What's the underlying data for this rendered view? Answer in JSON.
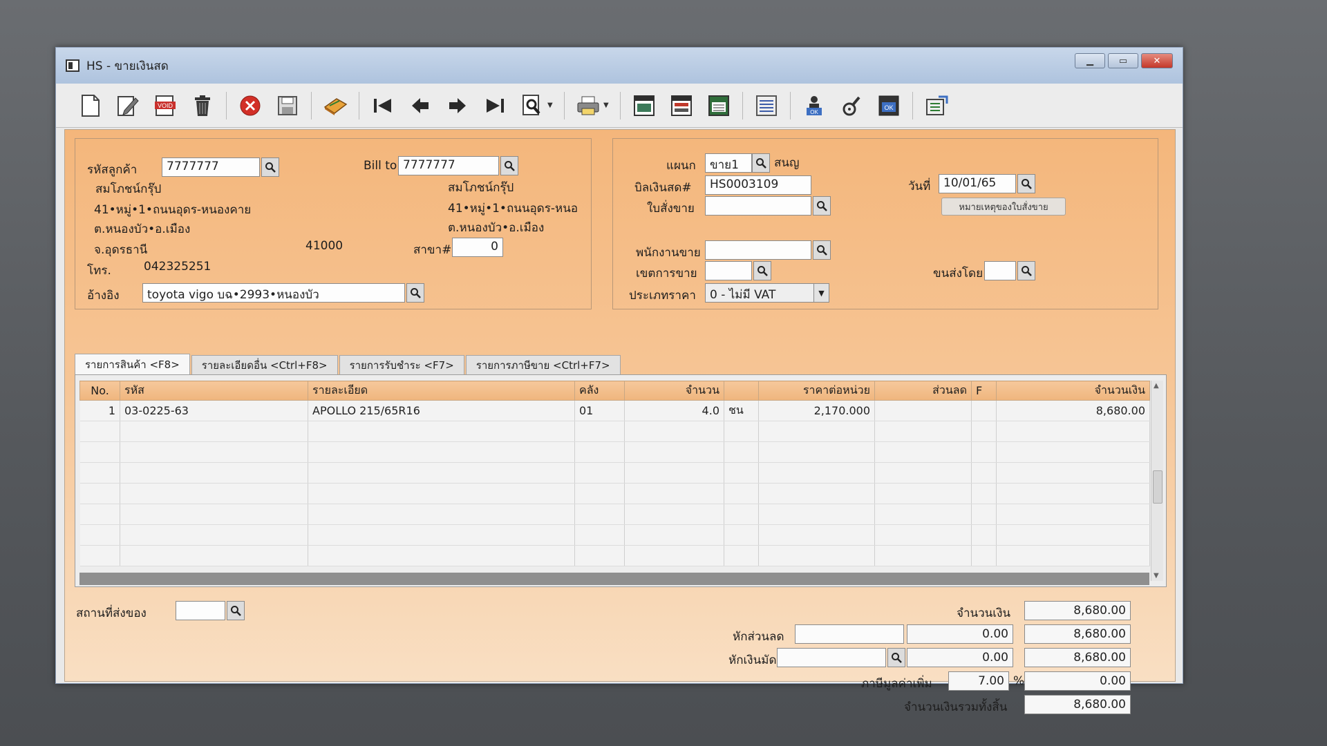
{
  "window": {
    "title": "HS - ขายเงินสด"
  },
  "toolbar": {
    "buttons": [
      "new-doc-icon",
      "edit-icon",
      "void-icon",
      "trash-icon",
      "cancel-icon",
      "save-icon",
      "notebook-icon",
      "first-record-icon",
      "prev-record-icon",
      "next-record-icon",
      "last-record-icon",
      "find-icon",
      "print-icon",
      "report-1-icon",
      "report-2-icon",
      "report-3-icon",
      "list-icon",
      "approve-icon",
      "tool-icon",
      "ok-icon",
      "export-icon"
    ],
    "void_label": "VOID",
    "ok_label": "OK"
  },
  "customer": {
    "code_label": "รหัสลูกค้า",
    "code": "7777777",
    "billto_label": "Bill to",
    "billto_code": "7777777",
    "name": "สมโภชน์กรุ๊ป",
    "address1": "41•หมู่•1•ถนนอุดร-หนองคาย",
    "address2": "ต.หนองบัว•อ.เมือง",
    "province": "จ.อุดรธานี",
    "postcode": "41000",
    "bill_name": "สมโภชน์กรุ๊ป",
    "bill_address1": "41•หมู่•1•ถนนอุดร-หนอ",
    "bill_address2": "ต.หนองบัว•อ.เมือง",
    "branch_label": "สาขา#",
    "branch": "0",
    "phone_label": "โทร.",
    "phone": "042325251",
    "ref_label": "อ้างอิง",
    "ref": "toyota vigo บฉ•2993•หนองบัว"
  },
  "document": {
    "dept_label": "แผนก",
    "dept": "ขาย1",
    "dept_name": "สนญ",
    "bill_label": "บิลเงินสด#",
    "bill_no": "HS0003109",
    "date_label": "วันที่",
    "date": "10/01/65",
    "order_label": "ใบสั่งขาย",
    "order": "",
    "order_note_button": "หมายเหตุของใบสั่งขาย",
    "salesman_label": "พนักงานขาย",
    "salesman": "",
    "area_label": "เขตการขาย",
    "area": "",
    "shipby_label": "ขนส่งโดย",
    "shipby": "",
    "pricetype_label": "ประเภทราคา",
    "pricetype": "0 - ไม่มี VAT"
  },
  "tabs": [
    {
      "label": "รายการสินค้า <F8>"
    },
    {
      "label": "รายละเอียดอื่น <Ctrl+F8>"
    },
    {
      "label": "รายการรับชำระ <F7>"
    },
    {
      "label": "รายการภาษีขาย <Ctrl+F7>"
    }
  ],
  "grid": {
    "headers": [
      "No.",
      "รหัส",
      "รายละเอียด",
      "คลัง",
      "จำนวน",
      "",
      "ราคาต่อหน่วย",
      "ส่วนลด",
      "F",
      "จำนวนเงิน"
    ],
    "rows": [
      {
        "no": "1",
        "code": "03-0225-63",
        "desc": "APOLLO 215/65R16",
        "wh": "01",
        "qty": "4.0",
        "unit": "ชน",
        "price": "2,170.000",
        "disc": "",
        "f": "",
        "amount": "8,680.00"
      }
    ]
  },
  "footer": {
    "delivery_label": "สถานที่ส่งของ",
    "delivery": "",
    "amount_label": "จำนวนเงิน",
    "amount": "8,680.00",
    "discount_label": "หักส่วนลด",
    "discount_text": "",
    "discount_value": "0.00",
    "after_discount": "8,680.00",
    "deposit_label": "หักเงินมัดจำ",
    "deposit_text": "",
    "deposit_value": "0.00",
    "after_deposit": "8,680.00",
    "vat_label": "ภาษีมูลค่าเพิ่ม",
    "vat_rate": "7.00",
    "vat_pct": "%",
    "vat_amount": "0.00",
    "grand_label": "จำนวนเงินรวมทั้งสิ้น",
    "grand_total": "8,680.00"
  }
}
